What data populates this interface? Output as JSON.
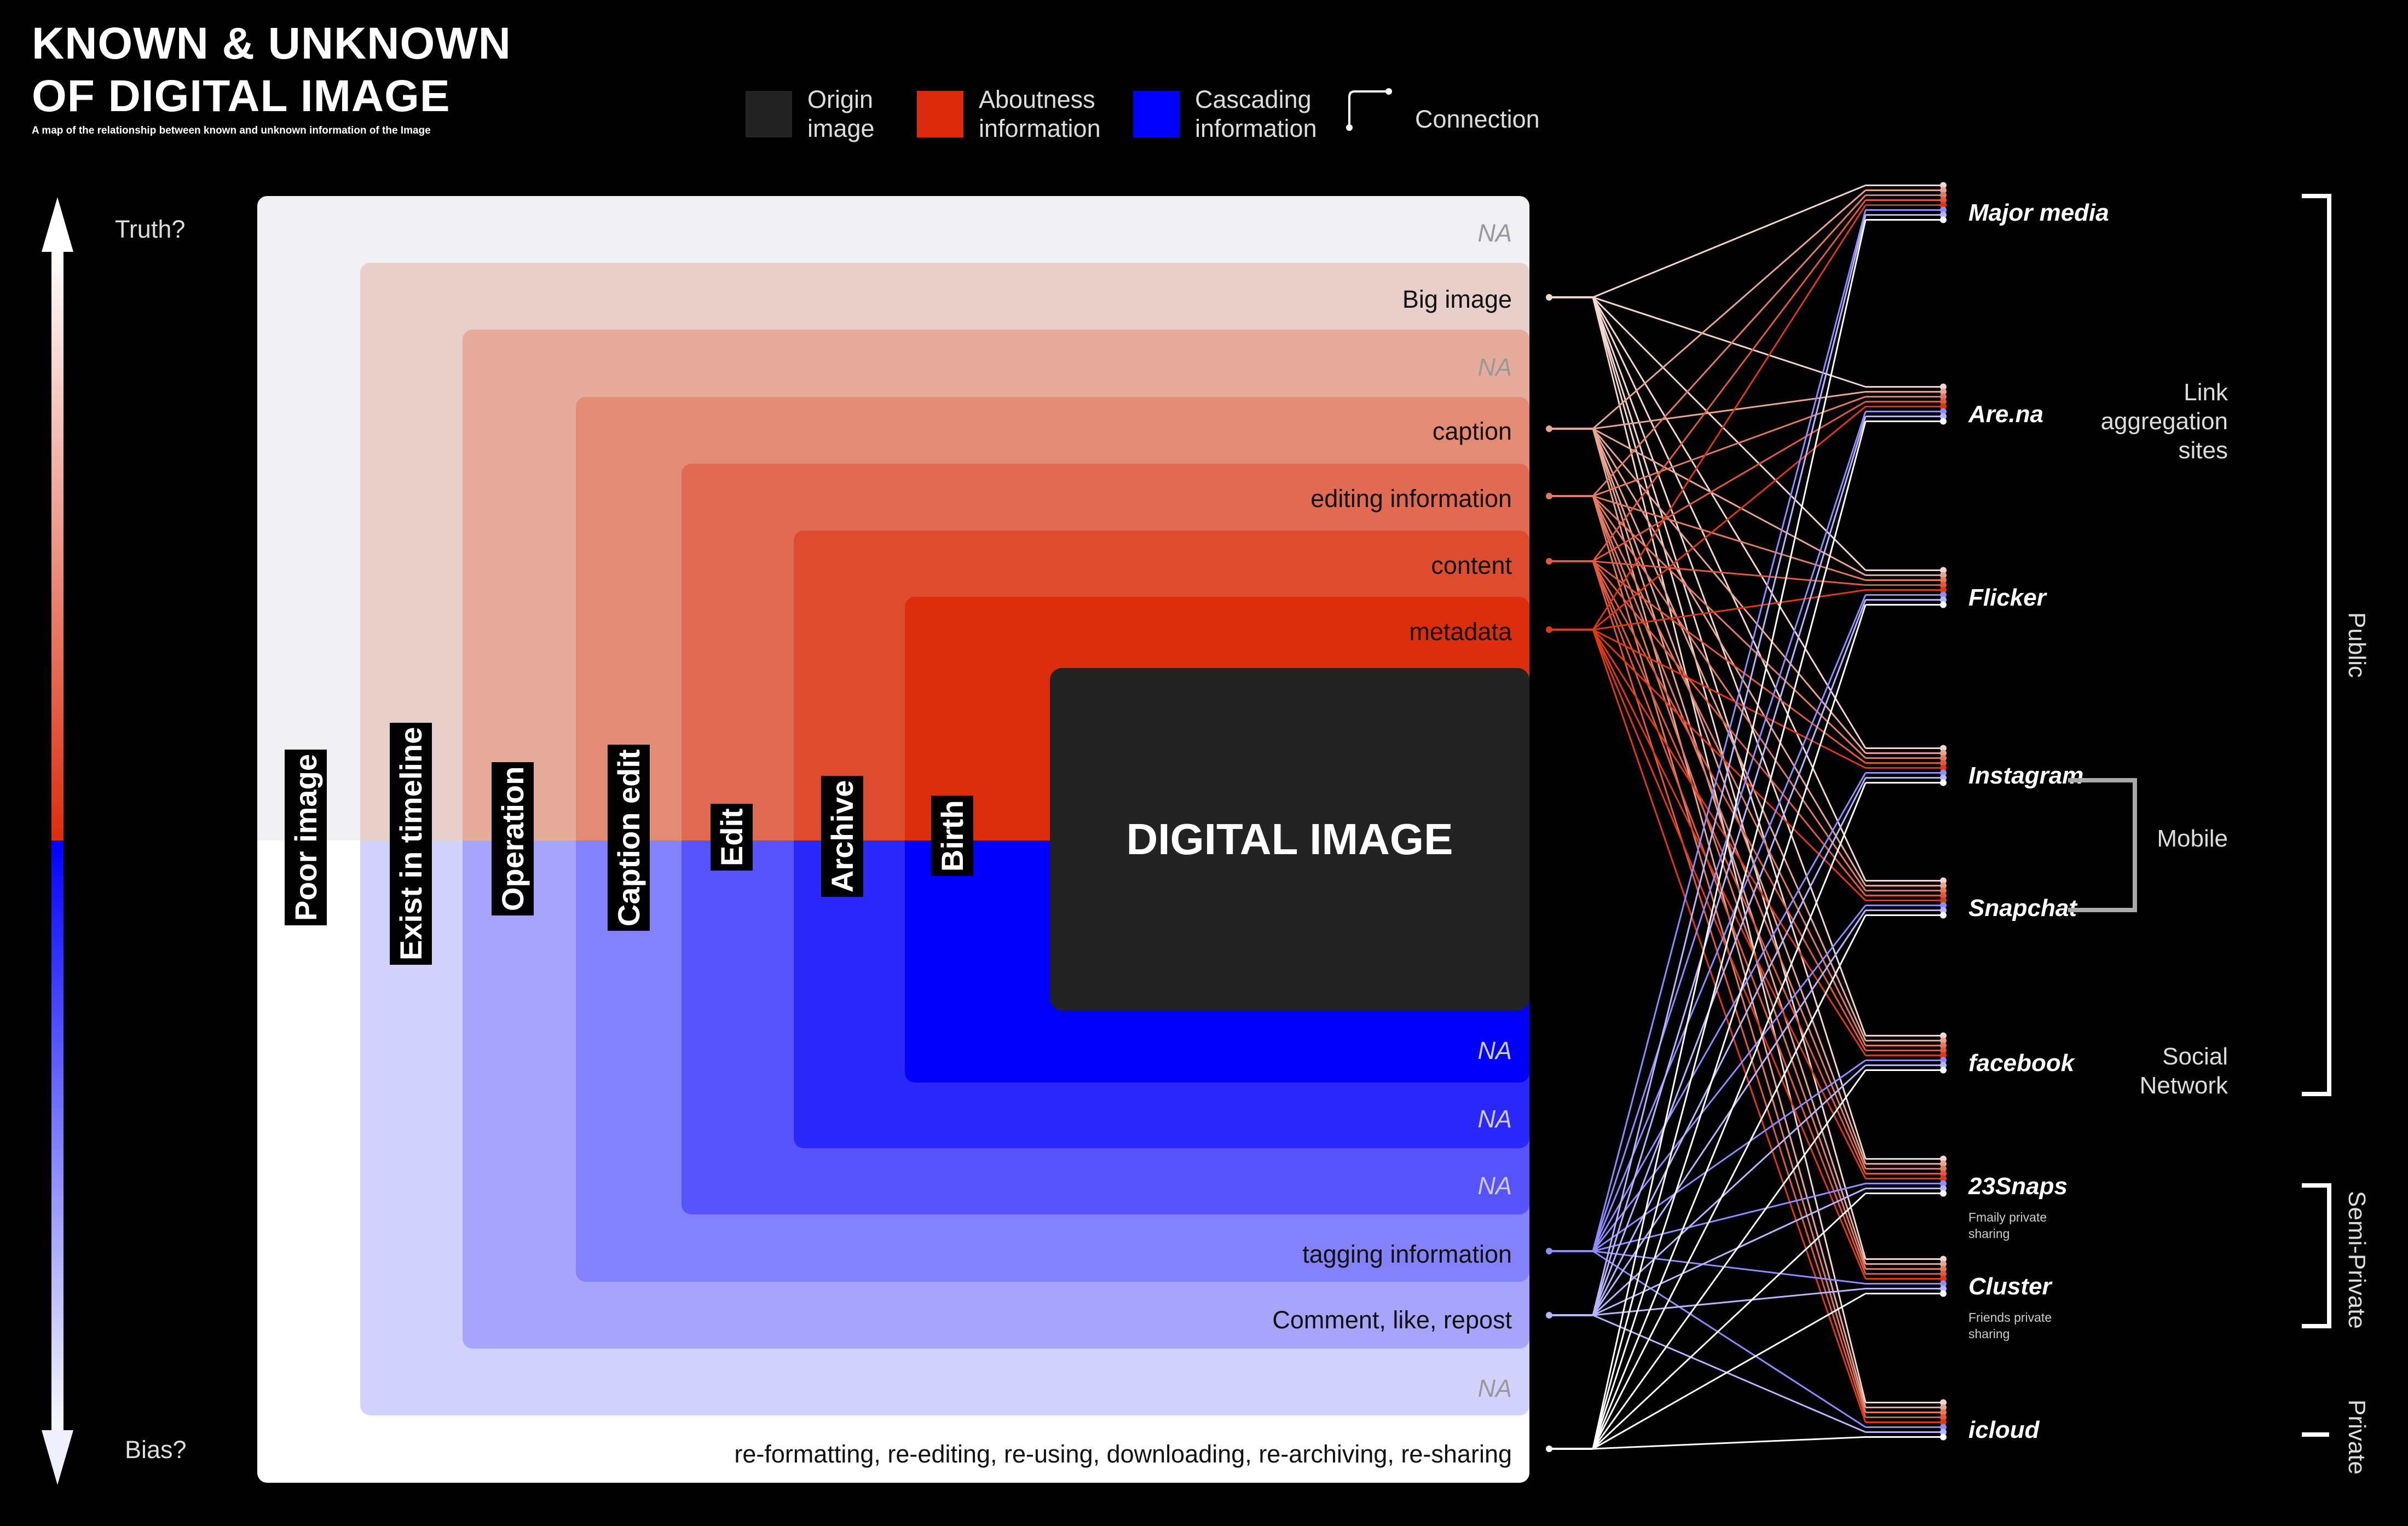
{
  "title": {
    "line1": "KNOWN & UNKNOWN",
    "line2": "OF DIGITAL IMAGE",
    "subtitle": "A map of the relationship between known and unknown information of the Image"
  },
  "legend": [
    {
      "label": "Origin\nimage",
      "color": "#232323"
    },
    {
      "label": "Aboutness\ninformation",
      "color": "#dd2a0c"
    },
    {
      "label": "Cascading\ninformation",
      "color": "#0000ff"
    },
    {
      "label": "Connection",
      "color": "#ffffff"
    }
  ],
  "axis": {
    "top": "Truth?",
    "bottom": "Bias?"
  },
  "layers": [
    {
      "tag": "Poor image",
      "top_label": "NA",
      "bottom_label": "re-formatting, re-editing, re-using, downloading, re-archiving, re-sharing",
      "top_color": "#f0eff1",
      "bottom_color": "#ffffff"
    },
    {
      "tag": "Exist in timeline",
      "top_label": "Big image",
      "bottom_label": "NA",
      "top_color": "#e9cfc9",
      "bottom_color": "#d3d2fc"
    },
    {
      "tag": "Operation",
      "top_label": "NA",
      "bottom_label": "Comment, like, repost",
      "top_color": "#e6ab9b",
      "bottom_color": "#a6a4fc"
    },
    {
      "tag": "Caption edit",
      "top_label": "caption",
      "bottom_label": "tagging information",
      "top_color": "#e38b75",
      "bottom_color": "#8481fc"
    },
    {
      "tag": "Edit",
      "top_label": "editing information",
      "bottom_label": "NA",
      "top_color": "#e06a52",
      "bottom_color": "#5653fc"
    },
    {
      "tag": "Archive",
      "top_label": "content",
      "bottom_label": "NA",
      "top_color": "#de4c30",
      "bottom_color": "#2b28fc"
    },
    {
      "tag": "Birth",
      "top_label": "metadata",
      "bottom_label": "NA",
      "top_color": "#dc2d0c",
      "bottom_color": "#0000fb"
    }
  ],
  "core_label": "DIGITAL IMAGE",
  "platforms": [
    {
      "name": "Major media",
      "note": ""
    },
    {
      "name": "Are.na",
      "note": ""
    },
    {
      "name": "Flicker",
      "note": ""
    },
    {
      "name": "Instagram",
      "note": ""
    },
    {
      "name": "Snapchat",
      "note": ""
    },
    {
      "name": "facebook",
      "note": ""
    },
    {
      "name": "23Snaps",
      "note": "Fmaily private\nsharing"
    },
    {
      "name": "Cluster",
      "note": "Friends private\nsharing"
    },
    {
      "name": "icloud",
      "note": ""
    }
  ],
  "groups": {
    "link": "Link\naggregation\nsites",
    "mobile": "Mobile",
    "social": "Social\nNetwork",
    "public": "Public",
    "semi": "Semi-Private",
    "private": "Private"
  }
}
